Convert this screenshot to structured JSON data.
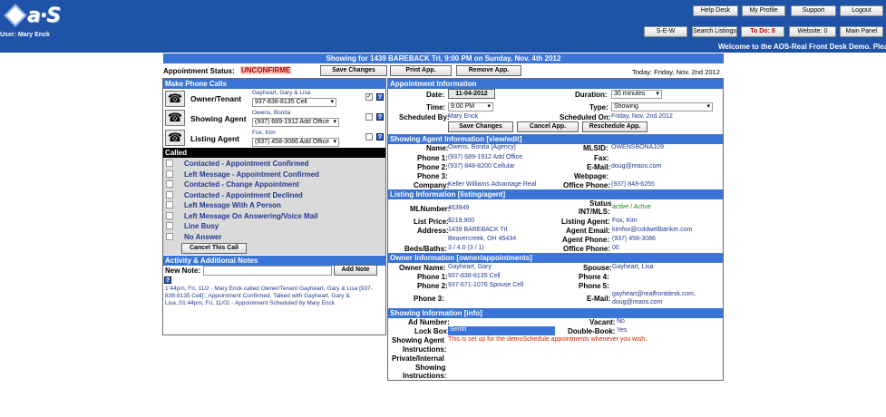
{
  "header": {
    "logo_text": "a·S",
    "user_label": "User: Mary Enck",
    "buttons": {
      "help_desk": "Help Desk",
      "my_profile": "My Profile",
      "support": "Support",
      "logout": "Logout",
      "sew": "S-E-W",
      "search_listings": "Search Listings",
      "to_do": "To Do: 8",
      "website": "Website: 0",
      "main_panel": "Main Panel"
    },
    "welcome": "Welcome to the AOS-Real Front Desk Demo. Plea"
  },
  "showing_title": "Showing for 1439 BAREBACK Trl, 9:00 PM on Sunday, Nov. 4th 2012",
  "status_row": {
    "label": "Appointment Status:",
    "status": "UNCONFIRME",
    "save_changes": "Save Changes",
    "print_app": "Print App.",
    "remove_app": "Remove App.",
    "today": "Today: Friday, Nov. 2nd 2012"
  },
  "phone_calls": {
    "title": "Make Phone Calls",
    "rows": [
      {
        "role": "Owner/Tenant",
        "name": "Gayheart, Gary & Lisa",
        "phone": "937-838-8135 Cell",
        "checked": "✓"
      },
      {
        "role": "Showing Agent",
        "name": "Owens, Bonita",
        "phone": "(937) 689-1912 Add Office",
        "checked": ""
      },
      {
        "role": "Listing Agent",
        "name": "Fox, Kim",
        "phone": "(937) 458-3086 Add Office",
        "checked": ""
      }
    ]
  },
  "called": {
    "title": "Called",
    "items": [
      "Contacted - Appointment Confirmed",
      "Left Message - Appointment Confirmed",
      "Contacted - Change Appointment",
      "Contacted - Appointment Declined",
      "Left Message With A Person",
      "Left Message On Answering/Voice Mail",
      "Line Busy",
      "No Answer"
    ],
    "cancel_call": "Cancel This Call"
  },
  "activity": {
    "title": "Activity & Additional Notes",
    "new_note_label": "New Note:",
    "add_note": "Add Note",
    "log": "1:44pm, Fri, 11/2 - Mary Enck called Owner/Tenant Gayheart, Gary & Lisa [937-838-8135 Cell]:; Appointment Confirmed. Talked with Gayheart, Gary & Lisa.;01:44pm, Fri, 11/02 - Appointment Scheduled by Mary Enck"
  },
  "appointment": {
    "title": "Appointment Information",
    "date_label": "Date:",
    "date": "11-04-2012",
    "duration_label": "Duration:",
    "duration": "30 minutes",
    "time_label": "Time:",
    "time": "9:00 PM",
    "type_label": "Type:",
    "type": "Showing",
    "scheduled_by_label": "Scheduled By:",
    "scheduled_by": "Mary Enck",
    "scheduled_on_label": "Scheduled On:",
    "scheduled_on": "Friday, Nov. 2nd 2012",
    "save_changes": "Save Changes",
    "cancel_app": "Cancel App.",
    "reschedule_app": "Reschedule App."
  },
  "showing_agent": {
    "title": "Showing Agent Information [view/edit]",
    "name_label": "Name:",
    "name": "Owens, Bonita [Agency]",
    "phone1_label": "Phone 1:",
    "phone1": "(937) 689-1912 Add Office",
    "phone2_label": "Phone 2:",
    "phone2": "(937) 848-8200 Cellular",
    "phone3_label": "Phone 3:",
    "company_label": "Company:",
    "company": "Keller Williams Advantage Real",
    "mlsid_label": "MLSID:",
    "mlsid": "OWENSBONA109",
    "fax_label": "Fax:",
    "email_label": "E-Mail:",
    "email": "doug@reaos.com",
    "webpage_label": "Webpage:",
    "office_phone_label": "Office Phone:",
    "office_phone": "(937) 848-6255"
  },
  "listing": {
    "title": "Listing Information [listing/agent]",
    "mlnumber_label": "MLNumber:",
    "mlnumber": "463949",
    "status_label": "Status",
    "int_mls_label": "INT/MLS:",
    "status": "active / Active",
    "list_price_label": "List Price:",
    "list_price": "$219,900",
    "address_label": "Address:",
    "address1": "1439 BAREBACK Trl",
    "address2": "Beavercreek, OH 45434",
    "beds_label": "Beds/Baths:",
    "beds": "3 / 4.0 (3 / 1)",
    "listing_agent_label": "Listing Agent:",
    "listing_agent": "Fox, Kim",
    "agent_email_label": "Agent Email:",
    "agent_email": "kimfox@coldwellbanker.com",
    "agent_phone_label": "Agent Phone:",
    "agent_phone": "(937) 458-3086",
    "office_phone_label": "Office Phone:",
    "office_phone": "00"
  },
  "owner": {
    "title": "Owner Information [owner/appointments]",
    "owner_name_label": "Owner Name:",
    "owner_name": "Gayheart, Gary",
    "phone1_label": "Phone 1:",
    "phone1": "937-838-8135 Cell",
    "phone2_label": "Phone 2:",
    "phone2": "937-671-1076 Spouse Cell",
    "phone3_label": "Phone 3:",
    "spouse_label": "Spouse:",
    "spouse": "Gayheart, Lisa",
    "phone4_label": "Phone 4:",
    "phone5_label": "Phone 5:",
    "email_label": "E-Mail:",
    "email1": "gayheart@realfrontdesk.com,",
    "email2": "doug@reaos.com"
  },
  "showing_info": {
    "title": "Showing Information [info]",
    "ad_number_label": "Ad Number:",
    "lock_box_label": "Lock Box:",
    "lock_box": "Sentri",
    "agent_instr_label1": "Showing Agent",
    "agent_instr_label2": "Instructions:",
    "agent_instr": "This is set up for the demoSchedule appointments whenever you wish.",
    "private_label1": "Private/Internal",
    "private_label2": "Showing",
    "private_label3": "Instructions:",
    "vacant_label": "Vacant:",
    "vacant": "No",
    "double_book_label": "Double-Book:",
    "double_book": "Yes"
  }
}
